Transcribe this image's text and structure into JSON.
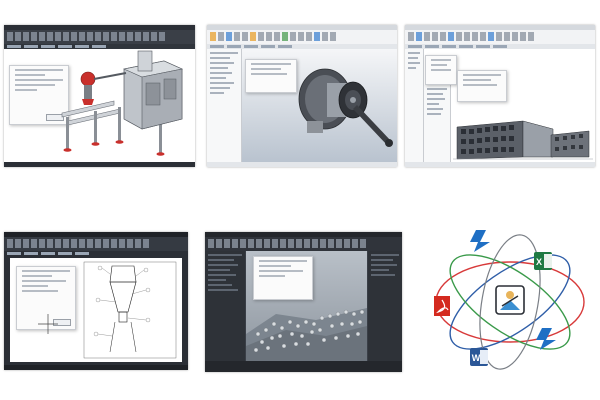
{
  "thumbnails": [
    {
      "name": "autocad-mechanical-machine-thumbnail",
      "theme": "dark-ribbon",
      "subject": "machine"
    },
    {
      "name": "inventor-assembly-thumbnail",
      "theme": "light-ribbon",
      "subject": "reel"
    },
    {
      "name": "revit-building-thumbnail",
      "theme": "light-ribbon",
      "subject": "building"
    },
    {
      "name": "autocad-drawing-thumbnail",
      "theme": "dark",
      "subject": "drawing"
    },
    {
      "name": "3dsmax-scene-thumbnail",
      "theme": "dark",
      "subject": "terrain"
    }
  ],
  "logo": {
    "name": "file-formats-atom-logo",
    "badges": {
      "excel": "X",
      "word": "W"
    }
  },
  "colors": {
    "dark_ui": "#2b2f36",
    "light_ui": "#f2f3f5",
    "accent_blue": "#1f6fc4",
    "acrobat_red": "#d42a1f",
    "excel_green": "#1f7a43",
    "word_blue": "#2b5797",
    "orbit_red": "#d83a3a",
    "orbit_blue": "#2f5ea8",
    "orbit_green": "#3a9a4a"
  }
}
